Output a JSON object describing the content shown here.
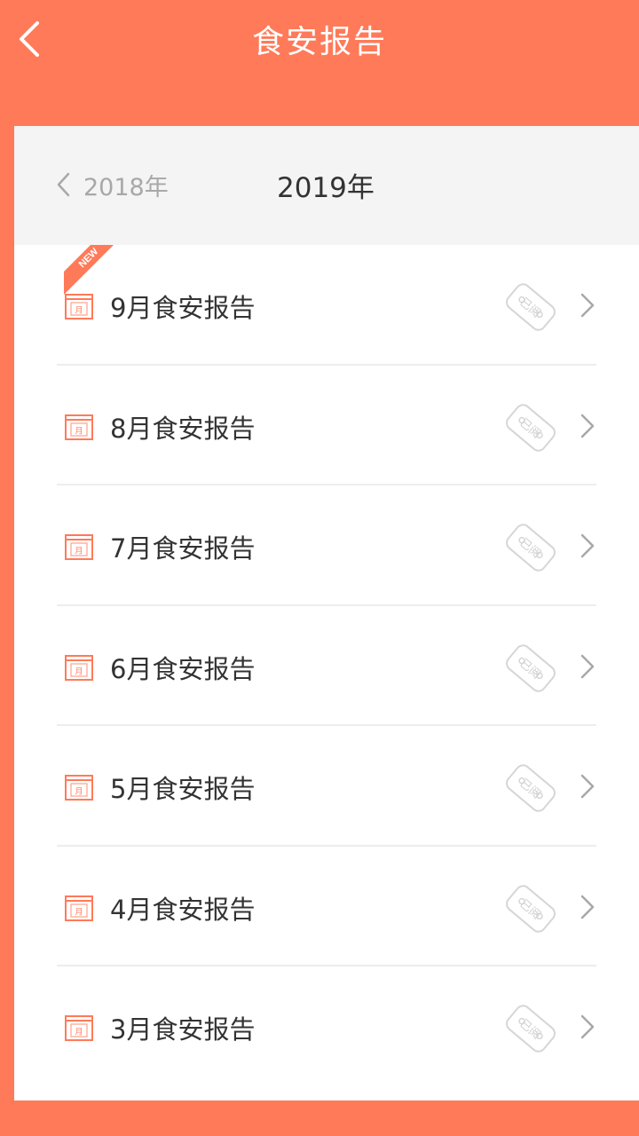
{
  "header": {
    "title": "食安报告"
  },
  "year_selector": {
    "prev_year": "2018年",
    "current_year": "2019年"
  },
  "reports": [
    {
      "label": "9月食安报告",
      "is_new": true,
      "badge": "NEW",
      "stamp": "已阅"
    },
    {
      "label": "8月食安报告",
      "is_new": false,
      "stamp": "已阅"
    },
    {
      "label": "7月食安报告",
      "is_new": false,
      "stamp": "已阅"
    },
    {
      "label": "6月食安报告",
      "is_new": false,
      "stamp": "已阅"
    },
    {
      "label": "5月食安报告",
      "is_new": false,
      "stamp": "已阅"
    },
    {
      "label": "4月食安报告",
      "is_new": false,
      "stamp": "已阅"
    },
    {
      "label": "3月食安报告",
      "is_new": false,
      "stamp": "已阅"
    }
  ],
  "icons": {
    "month_icon_text": "月"
  },
  "colors": {
    "brand": "#FF7A59",
    "year_bar": "#F4F4F4",
    "divider": "#EDEDED"
  }
}
